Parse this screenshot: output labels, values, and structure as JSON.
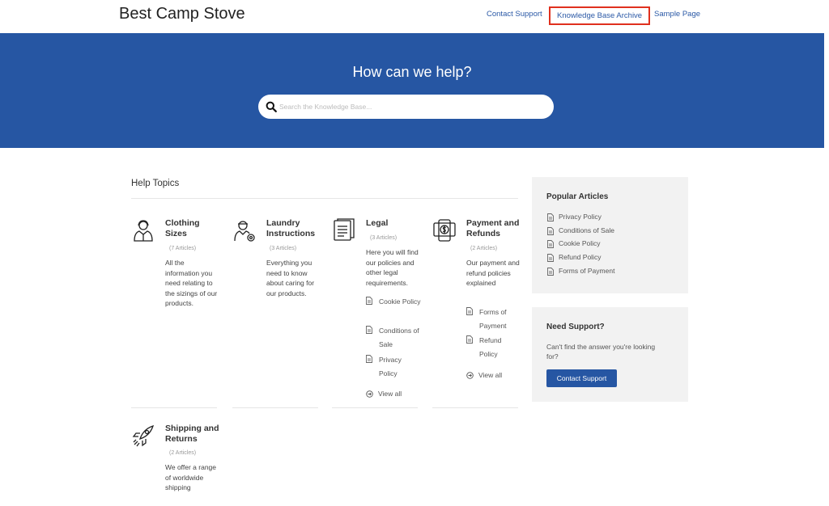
{
  "site": {
    "title": "Best Camp Stove"
  },
  "nav": [
    {
      "label": "Contact Support"
    },
    {
      "label": "Knowledge Base Archive"
    },
    {
      "label": "Sample Page"
    }
  ],
  "hero": {
    "title": "How can we help?",
    "search_placeholder": "Search the Knowledge Base..."
  },
  "topics": {
    "heading": "Help Topics",
    "cards": [
      {
        "icon": "clothing-icon",
        "title": "Clothing Sizes",
        "count": "(7 Articles)",
        "description": "All the information you need relating to the sizings of our products.",
        "articles": [],
        "view_all": ""
      },
      {
        "icon": "laundry-icon",
        "title": "Laundry Instructions",
        "count": "(3 Articles)",
        "description": "Everything you need to know about caring for our products.",
        "articles": [],
        "view_all": ""
      },
      {
        "icon": "legal-document-icon",
        "title": "Legal",
        "count": "(3 Articles)",
        "description": "Here you will find our policies and other legal requirements.",
        "articles": [
          "Cookie Policy",
          "Conditions of Sale",
          "Privacy Policy"
        ],
        "view_all": "View all"
      },
      {
        "icon": "payment-icon",
        "title": "Payment and Refunds",
        "count": "(2 Articles)",
        "description": "Our payment and refund policies explained",
        "articles": [
          "Forms of Payment",
          "Refund Policy"
        ],
        "view_all": "View all"
      },
      {
        "icon": "rocket-icon",
        "title": "Shipping and Returns",
        "count": "(2 Articles)",
        "description": "We offer a range of worldwide shipping",
        "articles": [],
        "view_all": ""
      }
    ]
  },
  "sidebar": {
    "popular": {
      "title": "Popular Articles",
      "items": [
        "Privacy Policy",
        "Conditions of Sale",
        "Cookie Policy",
        "Refund Policy",
        "Forms of Payment"
      ]
    },
    "support": {
      "title": "Need Support?",
      "text": "Can't find the answer you're looking for?",
      "button": "Contact Support"
    }
  },
  "colors": {
    "primary": "#2656a3",
    "highlight": "#e0301e",
    "panel": "#f2f2f2"
  }
}
